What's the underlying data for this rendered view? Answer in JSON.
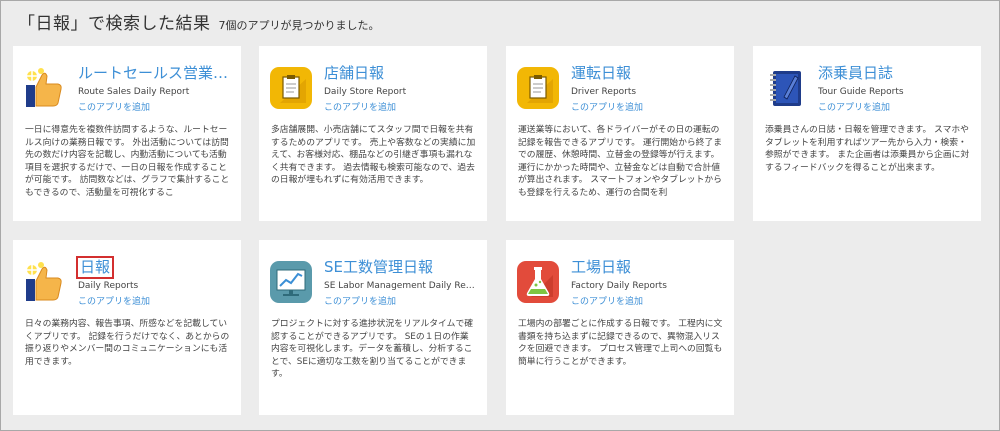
{
  "search": {
    "title": "「日報」で検索した結果",
    "count_text": "7個のアプリが見つかりました。"
  },
  "apps": [
    {
      "name": "ルートセールス営業…",
      "subtitle": "Route Sales Daily Report",
      "add_label": "このアプリを追加",
      "icon": "thumbs-up-icon",
      "description": "一日に得意先を複数件訪問するような、ルートセールス向けの業務日報です。 外出活動については訪問先の数だけ内容を記載し、内勤活動についても活動項目を選択するだけで、一日の日報を作成することが可能です。 訪問数などは、グラフで集計することもできるので、活動量を可視化するこ"
    },
    {
      "name": "店舗日報",
      "subtitle": "Daily Store Report",
      "add_label": "このアプリを追加",
      "icon": "clipboard-icon",
      "description": "多店舗展開、小売店舗にてスタッフ間で日報を共有するためのアプリです。 売上や客数などの実績に加えて、お客様対応、棚品などの引継ぎ事項も漏れなく共有できます。 過去情報も検索可能なので、過去の日報が埋もれずに有効活用できます。"
    },
    {
      "name": "運転日報",
      "subtitle": "Driver Reports",
      "add_label": "このアプリを追加",
      "icon": "clipboard-icon",
      "description": "運送業等において、各ドライバーがその日の運転の記録を報告できるアプリです。 運行開始から終了までの履歴、休憩時間、立替金の登録等が行えます。 運行にかかった時間や、立替金などは自動で合計値が算出されます。 スマートフォンやタブレットからも登録を行えるため、運行の合間を利"
    },
    {
      "name": "添乗員日誌",
      "subtitle": "Tour Guide Reports",
      "add_label": "このアプリを追加",
      "icon": "notebook-icon",
      "description": "添乗員さんの日誌・日報を管理できます。 スマホやタブレットを利用すればツアー先から入力・検索・参照ができます。 また企画者は添乗員から企画に対するフィードバックを得ることが出来ます。"
    },
    {
      "name": "日報",
      "subtitle": "Daily Reports",
      "add_label": "このアプリを追加",
      "icon": "thumbs-up-icon",
      "description": "日々の業務内容、報告事項、所感などを記載していくアプリです。 記録を行うだけでなく、あとからの振り返りやメンバー間のコミュニケーションにも活用できます。"
    },
    {
      "name": "SE工数管理日報",
      "subtitle": "SE Labor Management Daily Re…",
      "add_label": "このアプリを追加",
      "icon": "line-chart-icon",
      "description": "プロジェクトに対する進捗状況をリアルタイムで確認することができるアプリです。 SEの１日の作業内容を可視化します。データを蓄積し、分析することで、SEに適切な工数を割り当てることができます。"
    },
    {
      "name": "工場日報",
      "subtitle": "Factory Daily Reports",
      "add_label": "このアプリを追加",
      "icon": "flask-icon",
      "description": "工場内の部署ごとに作成する日報です。 工程内に文書類を持ち込まずに記録できるので、異物混入リスクを回避できます。 プロセス管理で上司への回覧も簡単に行うことができます。"
    }
  ]
}
